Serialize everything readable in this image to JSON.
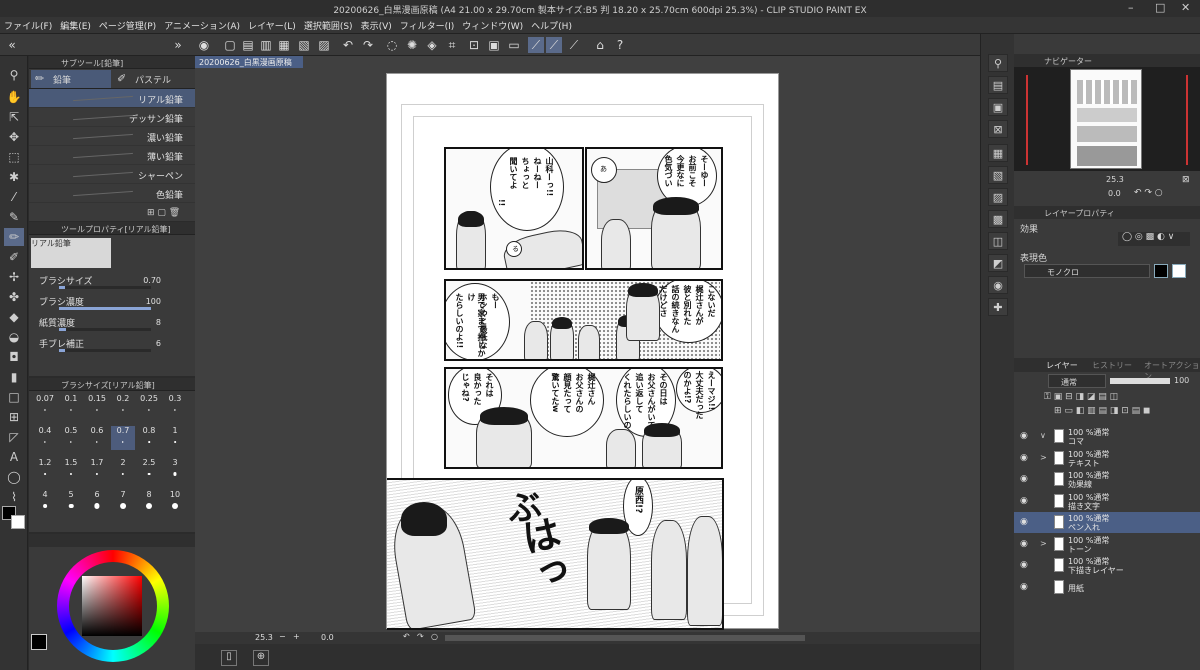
{
  "window": {
    "title": "20200626_白黒漫画原稿 (A4 21.00 x 29.70cm 製本サイズ:B5 判 18.20 x 25.70cm 600dpi 25.3%) - CLIP STUDIO PAINT EX"
  },
  "menu": [
    "ファイル(F)",
    "編集(E)",
    "ページ管理(P)",
    "アニメーション(A)",
    "レイヤー(L)",
    "選択範囲(S)",
    "表示(V)",
    "フィルター(I)",
    "ウィンドウ(W)",
    "ヘルプ(H)"
  ],
  "subtool_panel": {
    "header": "サブツール[鉛筆]",
    "tabs": [
      "鉛筆",
      "パステル"
    ],
    "items": [
      "リアル鉛筆",
      "デッサン鉛筆",
      "濃い鉛筆",
      "薄い鉛筆",
      "シャーペン",
      "色鉛筆"
    ]
  },
  "tool_property": {
    "header": "ツールプロパティ[リアル鉛筆]",
    "name": "リアル鉛筆",
    "props": [
      {
        "label": "ブラシサイズ",
        "value": "0.70",
        "level": 0.07
      },
      {
        "label": "ブラシ濃度",
        "value": "100",
        "level": 1.0
      },
      {
        "label": "紙質濃度",
        "value": "8",
        "level": 0.08
      },
      {
        "label": "手ブレ補正",
        "value": "6",
        "level": 0.06
      }
    ]
  },
  "brush_size": {
    "header": "ブラシサイズ[リアル鉛筆]",
    "sizes": [
      "0.07",
      "0.1",
      "0.15",
      "0.2",
      "0.25",
      "0.3",
      "0.4",
      "0.5",
      "0.6",
      "0.7",
      "0.8",
      "1",
      "1.2",
      "1.5",
      "1.7",
      "2",
      "2.5",
      "3",
      "4",
      "5",
      "6",
      "7",
      "8",
      "10"
    ],
    "selected": "0.7"
  },
  "document": {
    "tab": "20200626_白黒漫画原稿",
    "zoom": "25.3",
    "angle": "0.0"
  },
  "manga_text": {
    "p1a": "山科ーっ!!",
    "p1b": "ねーねー",
    "p1c": "ちょっと",
    "p1d": "聞いてよ",
    "p1e": "!!",
    "p1f": "そーゆー",
    "p1g": "お前こそ",
    "p1h": "今更なに",
    "p1i": "色気づい",
    "p1j": "あ",
    "p1k": "る",
    "p2a": "こないだ",
    "p2b": "梶辻さんが",
    "p2c": "彼と別れた",
    "p2d": "話の続きなん",
    "p2e": "だけどさ",
    "p2f": "もー",
    "p2g": "ホンっと最低な",
    "p2h": "男で家まで押しかけ",
    "p2i": "たらしいのよ!!",
    "p3a": "えーマジ!!",
    "p3b": "大丈夫だった",
    "p3c": "のかよ!?",
    "p3d": "その日は",
    "p3e": "お父さんがいて",
    "p3f": "追い返して",
    "p3g": "くれたらしいの",
    "p3h": "梶辻さん",
    "p3i": "お父さんの",
    "p3j": "顔見たって",
    "p3k": "驚いてたw",
    "p3l": "それは",
    "p3m": "良かった",
    "p3n": "じゃね?",
    "p4a": "原西!?",
    "p4b": "ぶ",
    "p4c": "はっ"
  },
  "navigator": {
    "header": "ナビゲーター",
    "zoom": "25.3",
    "angle": "0.0"
  },
  "layer_property": {
    "header": "レイヤープロパティ",
    "effect_label": "効果",
    "expression_label": "表現色",
    "expression_value": "モノクロ"
  },
  "layers_panel": {
    "tabs": [
      "レイヤー",
      "ヒストリー",
      "オートアクション"
    ],
    "blend_mode": "通常",
    "opacity": "100",
    "layers": [
      {
        "blend": "100 %通常",
        "name": "コマ",
        "fold": "∨"
      },
      {
        "blend": "100 %通常",
        "name": "テキスト",
        "fold": ">"
      },
      {
        "blend": "100 %通常",
        "name": "効果線",
        "fold": ""
      },
      {
        "blend": "100 %通常",
        "name": "描き文字",
        "fold": ""
      },
      {
        "blend": "100 %通常",
        "name": "ペン入れ",
        "fold": ""
      },
      {
        "blend": "100 %通常",
        "name": "トーン",
        "fold": ">"
      },
      {
        "blend": "100 %通常",
        "name": "下描きレイヤー",
        "fold": ""
      },
      {
        "blend": "",
        "name": "用紙",
        "fold": ""
      }
    ],
    "selected_index": 4
  },
  "colors": {
    "accent": "#4b5f86",
    "selected_swatch": "#000000"
  }
}
